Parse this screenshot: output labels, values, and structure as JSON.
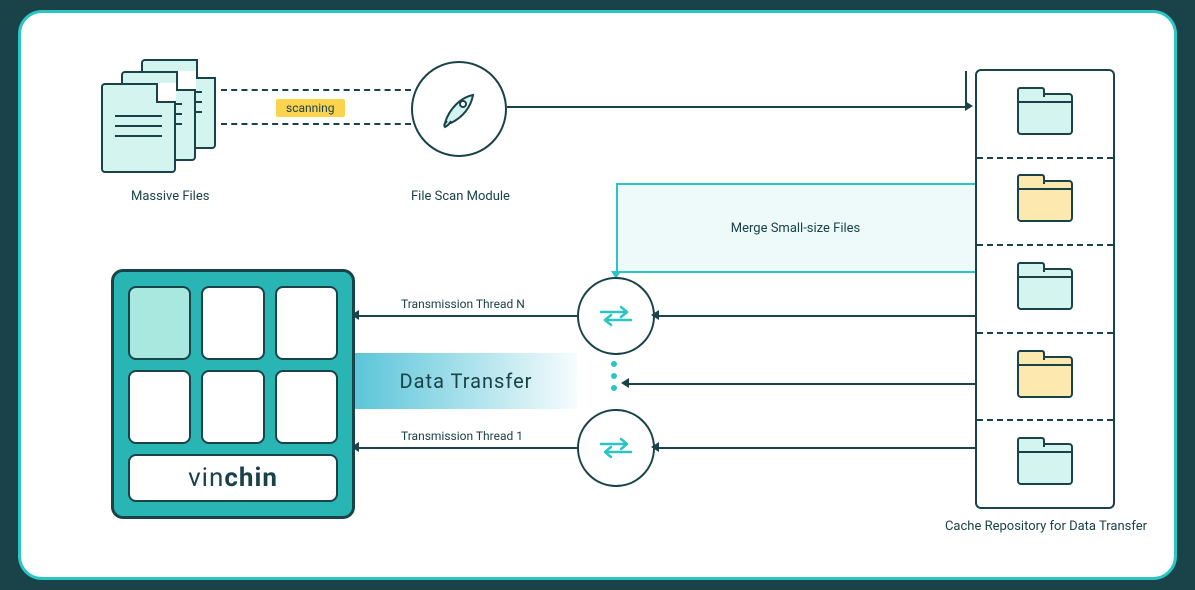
{
  "labels": {
    "massive_files": "Massive Files",
    "scanning": "scanning",
    "file_scan_module": "File Scan Module",
    "merge_small": "Merge Small-size Files",
    "tx_thread_n": "Transmission Thread N",
    "tx_thread_1": "Transmission Thread 1",
    "data_transfer": "Data Transfer",
    "cache_repo": "Cache Repository for Data Transfer",
    "brand_a": "vin",
    "brand_b": "chin"
  },
  "cache_slots": [
    "teal",
    "yellow",
    "teal",
    "yellow",
    "teal"
  ]
}
